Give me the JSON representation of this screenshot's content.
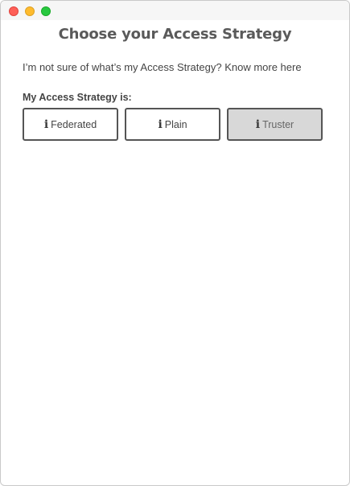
{
  "window": {
    "controls": [
      "close",
      "minimize",
      "zoom"
    ]
  },
  "page_title": "Choose your Access Strategy",
  "help_text": "I’m not sure of what’s my Access Strategy? Know more here",
  "section_label": "My Access Strategy is:",
  "options": [
    {
      "label": "Federated",
      "icon": "info-icon",
      "selected": false
    },
    {
      "label": "Plain",
      "icon": "info-icon",
      "selected": false
    },
    {
      "label": "Truster",
      "icon": "info-icon",
      "selected": true
    }
  ],
  "colors": {
    "selected_background": "#d8d8d8",
    "border": "#555555",
    "title_text": "#5a5a5a"
  }
}
